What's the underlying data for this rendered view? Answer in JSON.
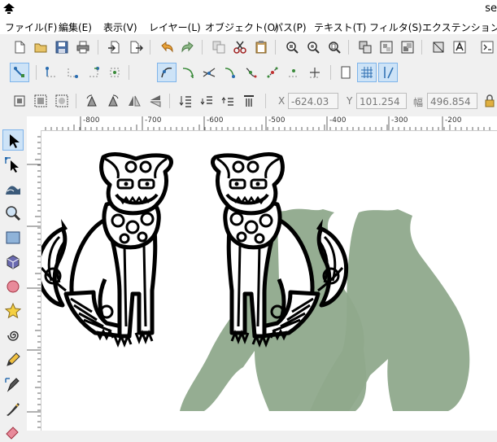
{
  "window": {
    "title": "se"
  },
  "menu": [
    {
      "label": "ファイル(F)"
    },
    {
      "label": "編集(E)"
    },
    {
      "label": "表示(V)"
    },
    {
      "label": "レイヤー(L)"
    },
    {
      "label": "オブジェクト(O)"
    },
    {
      "label": "パス(P)"
    },
    {
      "label": "テキスト(T)"
    },
    {
      "label": "フィルタ(S)"
    },
    {
      "label": "エクステンション(N)"
    }
  ],
  "coords": {
    "x_label": "X",
    "x_value": "-624.03",
    "y_label": "Y",
    "y_value": "101.254",
    "w_label": "幅",
    "w_value": "496.854"
  },
  "ruler": {
    "h_labels": [
      "-800",
      "-700",
      "-600",
      "-500",
      "-400",
      "-300",
      "-200"
    ]
  },
  "colors": {
    "accent": "#cde3f7",
    "shadow": "#8fa98c",
    "ink": "#000000"
  },
  "icons": {
    "tools": [
      "selector-icon",
      "node-editor-icon",
      "tweak-icon",
      "zoom-icon",
      "rectangle-icon",
      "box-3d-icon",
      "circle-icon",
      "star-icon",
      "spiral-icon",
      "pencil-icon",
      "pen-icon",
      "calligraphy-icon",
      "eraser-icon"
    ]
  }
}
